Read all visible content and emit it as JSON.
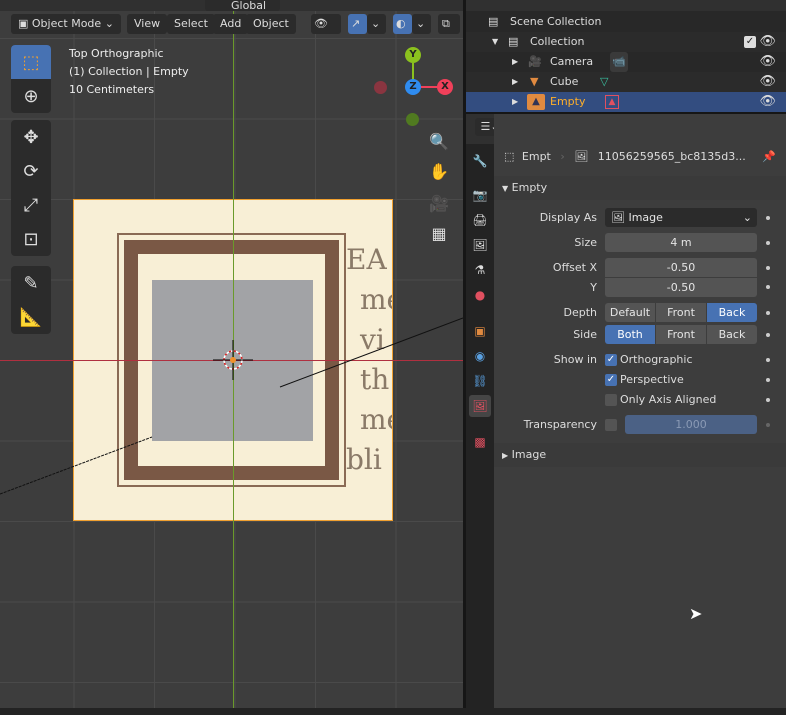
{
  "viewport": {
    "mode": "Object Mode",
    "menus": [
      "View",
      "Select",
      "Add",
      "Object"
    ],
    "transform_orientation": "Global",
    "overlay": [
      "Top Orthographic",
      "(1) Collection | Empty",
      "10 Centimeters"
    ],
    "gizmo_axes": {
      "x": "X",
      "y": "Y",
      "z": "Z"
    },
    "tools": [
      "select-box-icon",
      "cursor-icon",
      "move-icon",
      "rotate-icon",
      "scale-icon",
      "transform-icon",
      "annotate-icon",
      "measure-icon"
    ],
    "image_text": [
      "EA",
      "me",
      "vi",
      "th",
      "me",
      "bli"
    ]
  },
  "outliner": {
    "root": "Scene Collection",
    "collection": "Collection",
    "items": [
      {
        "name": "Camera",
        "data_icon": "camera-data-icon"
      },
      {
        "name": "Cube",
        "data_icon": "mesh-data-icon"
      },
      {
        "name": "Empty",
        "data_icon": "image-data-icon",
        "selected": true
      }
    ]
  },
  "properties": {
    "breadcrumb_object": "Empt",
    "breadcrumb_image": "11056259565_bc8135d3...",
    "panel_empty": "Empty",
    "display_as_label": "Display As",
    "display_as": "Image",
    "size_label": "Size",
    "size": "4 m",
    "offset_x_label": "Offset X",
    "offset_x": "-0.50",
    "offset_y_label": "Y",
    "offset_y": "-0.50",
    "depth_label": "Depth",
    "depth_options": [
      "Default",
      "Front",
      "Back"
    ],
    "depth_selected": "Back",
    "side_label": "Side",
    "side_options": [
      "Both",
      "Front",
      "Back"
    ],
    "side_selected": "Both",
    "show_in_label": "Show in",
    "orthographic": "Orthographic",
    "orthographic_checked": true,
    "perspective": "Perspective",
    "perspective_checked": true,
    "axis_aligned": "Only Axis Aligned",
    "axis_aligned_checked": false,
    "transparency_label": "Transparency",
    "transparency_checked": false,
    "transparency": "1.000",
    "panel_image": "Image"
  },
  "colors": {
    "accent": "#4772b3",
    "selected_row": "#334d80",
    "active_text": "#ffaf29"
  }
}
